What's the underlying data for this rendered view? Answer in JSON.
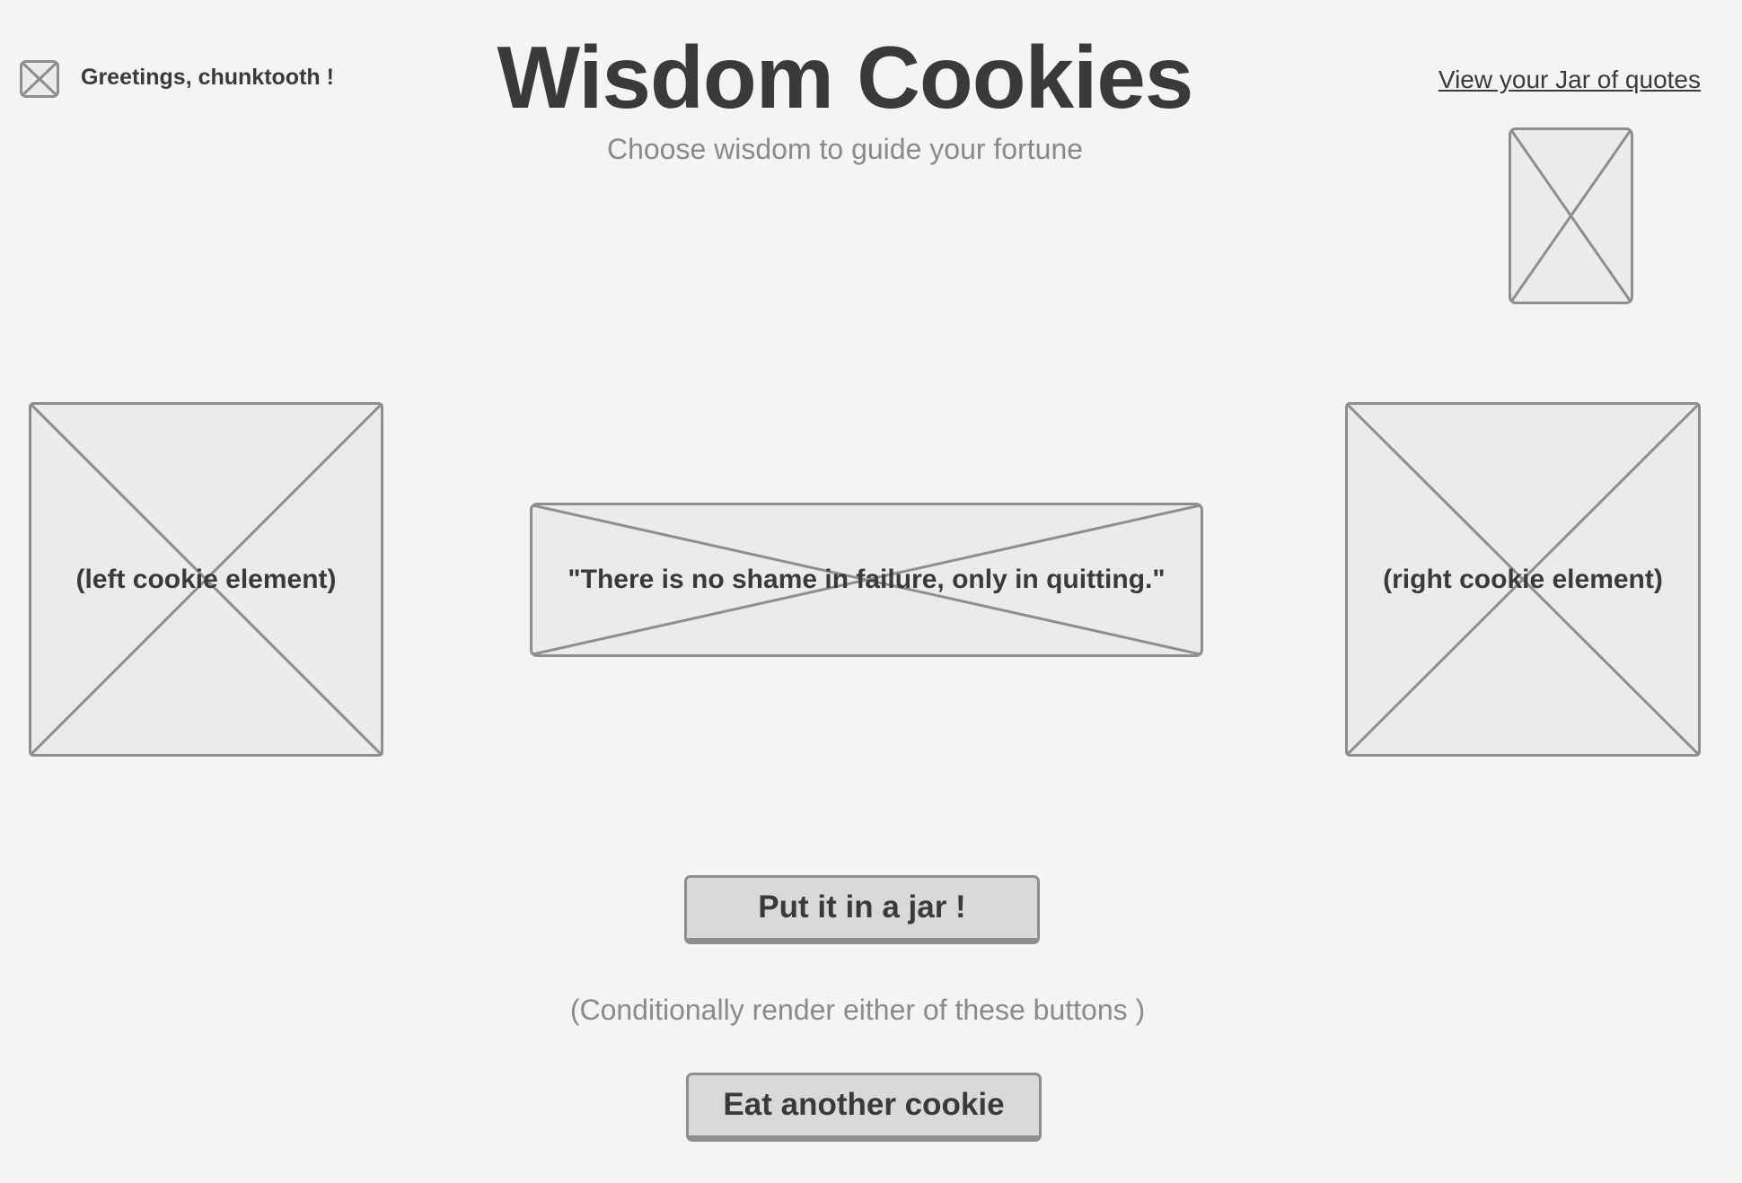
{
  "header": {
    "greeting": "Greetings, chunktooth !",
    "title": "Wisdom Cookies",
    "subtitle": "Choose wisdom to guide your fortune",
    "jar_link": "View your Jar of quotes",
    "avatar_icon": "image-placeholder-icon",
    "jar_icon": "jar-image-placeholder"
  },
  "main": {
    "left_cookie_label": "(left cookie element)",
    "right_cookie_label": "(right cookie element)",
    "quote": "\"There is no shame in failure, only in quitting.\""
  },
  "actions": {
    "put_in_jar_label": "Put it in a jar !",
    "note": "(Conditionally render either of these buttons )",
    "eat_another_label": "Eat another cookie"
  },
  "colors": {
    "background": "#f4f4f4",
    "text": "#3a3a3a",
    "muted_text": "#8a8a8a",
    "placeholder_fill": "#ebebeb",
    "placeholder_stroke": "#8e8e8e",
    "button_fill": "#d9d9d9"
  }
}
